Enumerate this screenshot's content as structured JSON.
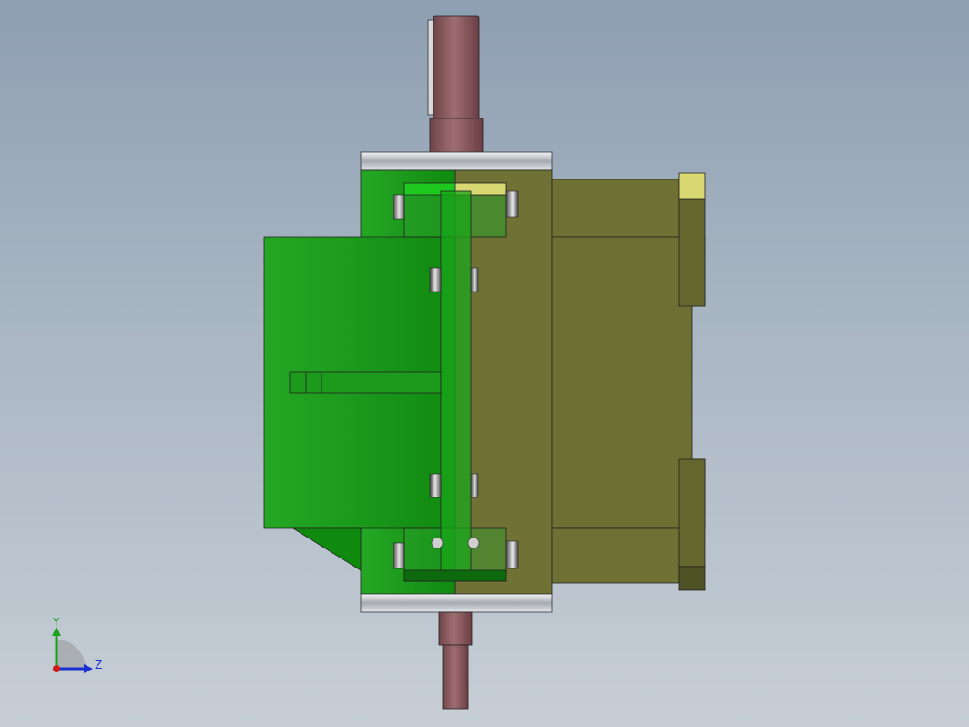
{
  "viewport": {
    "model_colors": {
      "green_part": "#1f9d1f",
      "olive_part": "#707236",
      "shaft": "#8a5a5e",
      "steel_ring": "#c8cbd0",
      "yellow_part": "#d8d870",
      "background_top": "#8e9fb2",
      "background_bottom": "#c7ced6"
    }
  },
  "triad": {
    "y_label": "Y",
    "z_label": "Z",
    "y_color": "#1aa01a",
    "z_color": "#1a2fd0",
    "x_color": "#d01a1a"
  }
}
